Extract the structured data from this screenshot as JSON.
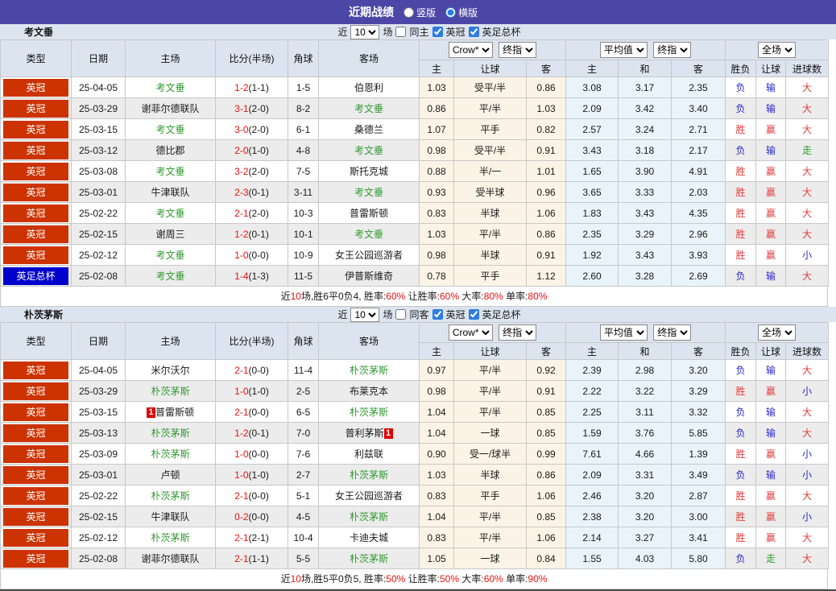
{
  "titlebar": {
    "title": "近期战绩",
    "radios": [
      {
        "label": "竖版",
        "selected": false
      },
      {
        "label": "横版",
        "selected": true
      }
    ]
  },
  "columns": {
    "main": [
      "类型",
      "日期",
      "主场",
      "比分(半场)",
      "角球",
      "客场"
    ],
    "sub": [
      "主",
      "让球",
      "客",
      "主",
      "和",
      "客",
      "胜负",
      "让球",
      "进球数"
    ]
  },
  "dropdowns": {
    "book": "Crow*",
    "book_period": "终指",
    "avg": "平均值",
    "avg_period": "终指",
    "scope": "全场"
  },
  "colors": {
    "league_badge": "#cc3300",
    "cup_badge": "#0000cc",
    "team_highlight": "#339933",
    "score_red": "#ee1111",
    "win_red": "#e03c3c",
    "lose_blue": "#2828cc",
    "void_green": "#2e9a2e",
    "titlebar_bg": "#4c46a6",
    "header_bg": "#dce4f0"
  },
  "sections": [
    {
      "team": "考文垂",
      "filter": {
        "near": "近",
        "count": "10",
        "games": "场",
        "same_label": "同主",
        "same_checked": false,
        "league_label": "英冠",
        "league_checked": true,
        "cup_label": "英足总杯",
        "cup_checked": true
      },
      "rows": [
        {
          "league": "英冠",
          "cup": false,
          "date": "25-04-05",
          "home": {
            "name": "考文垂",
            "green": true
          },
          "score": "1-2",
          "half": "(1-1)",
          "corners": "1-5",
          "away": {
            "name": "伯恩利",
            "green": false
          },
          "odds": [
            "1.03",
            "受平/半",
            "0.86"
          ],
          "avg": [
            "3.08",
            "3.17",
            "2.35"
          ],
          "res": [
            [
              "负",
              "b"
            ],
            [
              "输",
              "b"
            ],
            [
              "大",
              "r"
            ]
          ]
        },
        {
          "league": "英冠",
          "cup": false,
          "date": "25-03-29",
          "home": {
            "name": "谢菲尔德联队",
            "green": false
          },
          "score": "3-1",
          "half": "(2-0)",
          "corners": "8-2",
          "away": {
            "name": "考文垂",
            "green": true
          },
          "odds": [
            "0.86",
            "平/半",
            "1.03"
          ],
          "avg": [
            "2.09",
            "3.42",
            "3.40"
          ],
          "res": [
            [
              "负",
              "b"
            ],
            [
              "输",
              "b"
            ],
            [
              "大",
              "r"
            ]
          ]
        },
        {
          "league": "英冠",
          "cup": false,
          "date": "25-03-15",
          "home": {
            "name": "考文垂",
            "green": true
          },
          "score": "3-0",
          "half": "(2-0)",
          "corners": "6-1",
          "away": {
            "name": "桑德兰",
            "green": false
          },
          "odds": [
            "1.07",
            "平手",
            "0.82"
          ],
          "avg": [
            "2.57",
            "3.24",
            "2.71"
          ],
          "res": [
            [
              "胜",
              "r"
            ],
            [
              "赢",
              "r"
            ],
            [
              "大",
              "r"
            ]
          ]
        },
        {
          "league": "英冠",
          "cup": false,
          "date": "25-03-12",
          "home": {
            "name": "德比郡",
            "green": false
          },
          "score": "2-0",
          "half": "(1-0)",
          "corners": "4-8",
          "away": {
            "name": "考文垂",
            "green": true
          },
          "odds": [
            "0.98",
            "受平/半",
            "0.91"
          ],
          "avg": [
            "3.43",
            "3.18",
            "2.17"
          ],
          "res": [
            [
              "负",
              "b"
            ],
            [
              "输",
              "b"
            ],
            [
              "走",
              "g"
            ]
          ]
        },
        {
          "league": "英冠",
          "cup": false,
          "date": "25-03-08",
          "home": {
            "name": "考文垂",
            "green": true
          },
          "score": "3-2",
          "half": "(2-0)",
          "corners": "7-5",
          "away": {
            "name": "斯托克城",
            "green": false
          },
          "odds": [
            "0.88",
            "半/一",
            "1.01"
          ],
          "avg": [
            "1.65",
            "3.90",
            "4.91"
          ],
          "res": [
            [
              "胜",
              "r"
            ],
            [
              "赢",
              "r"
            ],
            [
              "大",
              "r"
            ]
          ]
        },
        {
          "league": "英冠",
          "cup": false,
          "date": "25-03-01",
          "home": {
            "name": "牛津联队",
            "green": false
          },
          "score": "2-3",
          "half": "(0-1)",
          "corners": "3-11",
          "away": {
            "name": "考文垂",
            "green": true
          },
          "odds": [
            "0.93",
            "受半球",
            "0.96"
          ],
          "avg": [
            "3.65",
            "3.33",
            "2.03"
          ],
          "res": [
            [
              "胜",
              "r"
            ],
            [
              "赢",
              "r"
            ],
            [
              "大",
              "r"
            ]
          ]
        },
        {
          "league": "英冠",
          "cup": false,
          "date": "25-02-22",
          "home": {
            "name": "考文垂",
            "green": true
          },
          "score": "2-1",
          "half": "(2-0)",
          "corners": "10-3",
          "away": {
            "name": "普雷斯顿",
            "green": false
          },
          "odds": [
            "0.83",
            "半球",
            "1.06"
          ],
          "avg": [
            "1.83",
            "3.43",
            "4.35"
          ],
          "res": [
            [
              "胜",
              "r"
            ],
            [
              "赢",
              "r"
            ],
            [
              "大",
              "r"
            ]
          ]
        },
        {
          "league": "英冠",
          "cup": false,
          "date": "25-02-15",
          "home": {
            "name": "谢周三",
            "green": false
          },
          "score": "1-2",
          "half": "(0-1)",
          "corners": "10-1",
          "away": {
            "name": "考文垂",
            "green": true
          },
          "odds": [
            "1.03",
            "平/半",
            "0.86"
          ],
          "avg": [
            "2.35",
            "3.29",
            "2.96"
          ],
          "res": [
            [
              "胜",
              "r"
            ],
            [
              "赢",
              "r"
            ],
            [
              "大",
              "r"
            ]
          ]
        },
        {
          "league": "英冠",
          "cup": false,
          "date": "25-02-12",
          "home": {
            "name": "考文垂",
            "green": true
          },
          "score": "1-0",
          "half": "(0-0)",
          "corners": "10-9",
          "away": {
            "name": "女王公园巡游者",
            "green": false
          },
          "odds": [
            "0.98",
            "半球",
            "0.91"
          ],
          "avg": [
            "1.92",
            "3.43",
            "3.93"
          ],
          "res": [
            [
              "胜",
              "r"
            ],
            [
              "赢",
              "r"
            ],
            [
              "小",
              "b"
            ]
          ]
        },
        {
          "league": "英足总杯",
          "cup": true,
          "date": "25-02-08",
          "home": {
            "name": "考文垂",
            "green": true
          },
          "score": "1-4",
          "half": "(1-3)",
          "corners": "11-5",
          "away": {
            "name": "伊普斯维奇",
            "green": false
          },
          "odds": [
            "0.78",
            "平手",
            "1.12"
          ],
          "avg": [
            "2.60",
            "3.28",
            "2.69"
          ],
          "res": [
            [
              "负",
              "b"
            ],
            [
              "输",
              "b"
            ],
            [
              "大",
              "r"
            ]
          ]
        }
      ],
      "summary": [
        [
          "近",
          0
        ],
        [
          "10",
          1
        ],
        [
          "场,胜6平0负4, 胜率:",
          0
        ],
        [
          "60%",
          1
        ],
        [
          " 让胜率:",
          0
        ],
        [
          "60%",
          1
        ],
        [
          " 大率:",
          0
        ],
        [
          "80%",
          1
        ],
        [
          " 单率:",
          0
        ],
        [
          "80%",
          1
        ]
      ]
    },
    {
      "team": "朴茨茅斯",
      "filter": {
        "near": "近",
        "count": "10",
        "games": "场",
        "same_label": "同客",
        "same_checked": false,
        "league_label": "英冠",
        "league_checked": true,
        "cup_label": "英足总杯",
        "cup_checked": true
      },
      "rows": [
        {
          "league": "英冠",
          "cup": false,
          "date": "25-04-05",
          "home": {
            "name": "米尔沃尔",
            "green": false
          },
          "score": "2-1",
          "half": "(0-0)",
          "corners": "11-4",
          "away": {
            "name": "朴茨茅斯",
            "green": true
          },
          "odds": [
            "0.97",
            "平/半",
            "0.92"
          ],
          "avg": [
            "2.39",
            "2.98",
            "3.20"
          ],
          "res": [
            [
              "负",
              "b"
            ],
            [
              "输",
              "b"
            ],
            [
              "大",
              "r"
            ]
          ]
        },
        {
          "league": "英冠",
          "cup": false,
          "date": "25-03-29",
          "home": {
            "name": "朴茨茅斯",
            "green": true
          },
          "score": "1-0",
          "half": "(1-0)",
          "corners": "2-5",
          "away": {
            "name": "布莱克本",
            "green": false
          },
          "odds": [
            "0.98",
            "平/半",
            "0.91"
          ],
          "avg": [
            "2.22",
            "3.22",
            "3.29"
          ],
          "res": [
            [
              "胜",
              "r"
            ],
            [
              "赢",
              "r"
            ],
            [
              "小",
              "b"
            ]
          ]
        },
        {
          "league": "英冠",
          "cup": false,
          "date": "25-03-15",
          "home": {
            "name": "普雷斯顿",
            "green": false,
            "card": "1",
            "card_pos": "before"
          },
          "score": "2-1",
          "half": "(0-0)",
          "corners": "6-5",
          "away": {
            "name": "朴茨茅斯",
            "green": true
          },
          "odds": [
            "1.04",
            "平/半",
            "0.85"
          ],
          "avg": [
            "2.25",
            "3.11",
            "3.32"
          ],
          "res": [
            [
              "负",
              "b"
            ],
            [
              "输",
              "b"
            ],
            [
              "大",
              "r"
            ]
          ]
        },
        {
          "league": "英冠",
          "cup": false,
          "date": "25-03-13",
          "home": {
            "name": "朴茨茅斯",
            "green": true
          },
          "score": "1-2",
          "half": "(0-1)",
          "corners": "7-0",
          "away": {
            "name": "普利茅斯",
            "green": false,
            "card": "1",
            "card_pos": "after"
          },
          "odds": [
            "1.04",
            "一球",
            "0.85"
          ],
          "avg": [
            "1.59",
            "3.76",
            "5.85"
          ],
          "res": [
            [
              "负",
              "b"
            ],
            [
              "输",
              "b"
            ],
            [
              "大",
              "r"
            ]
          ]
        },
        {
          "league": "英冠",
          "cup": false,
          "date": "25-03-09",
          "home": {
            "name": "朴茨茅斯",
            "green": true
          },
          "score": "1-0",
          "half": "(0-0)",
          "corners": "7-6",
          "away": {
            "name": "利兹联",
            "green": false
          },
          "odds": [
            "0.90",
            "受一/球半",
            "0.99"
          ],
          "avg": [
            "7.61",
            "4.66",
            "1.39"
          ],
          "res": [
            [
              "胜",
              "r"
            ],
            [
              "赢",
              "r"
            ],
            [
              "小",
              "b"
            ]
          ]
        },
        {
          "league": "英冠",
          "cup": false,
          "date": "25-03-01",
          "home": {
            "name": "卢顿",
            "green": false
          },
          "score": "1-0",
          "half": "(1-0)",
          "corners": "2-7",
          "away": {
            "name": "朴茨茅斯",
            "green": true
          },
          "odds": [
            "1.03",
            "半球",
            "0.86"
          ],
          "avg": [
            "2.09",
            "3.31",
            "3.49"
          ],
          "res": [
            [
              "负",
              "b"
            ],
            [
              "输",
              "b"
            ],
            [
              "小",
              "b"
            ]
          ]
        },
        {
          "league": "英冠",
          "cup": false,
          "date": "25-02-22",
          "home": {
            "name": "朴茨茅斯",
            "green": true
          },
          "score": "2-1",
          "half": "(0-0)",
          "corners": "5-1",
          "away": {
            "name": "女王公园巡游者",
            "green": false
          },
          "odds": [
            "0.83",
            "平手",
            "1.06"
          ],
          "avg": [
            "2.46",
            "3.20",
            "2.87"
          ],
          "res": [
            [
              "胜",
              "r"
            ],
            [
              "赢",
              "r"
            ],
            [
              "大",
              "r"
            ]
          ]
        },
        {
          "league": "英冠",
          "cup": false,
          "date": "25-02-15",
          "home": {
            "name": "牛津联队",
            "green": false
          },
          "score": "0-2",
          "half": "(0-0)",
          "corners": "4-5",
          "away": {
            "name": "朴茨茅斯",
            "green": true
          },
          "odds": [
            "1.04",
            "平/半",
            "0.85"
          ],
          "avg": [
            "2.38",
            "3.20",
            "3.00"
          ],
          "res": [
            [
              "胜",
              "r"
            ],
            [
              "赢",
              "r"
            ],
            [
              "小",
              "b"
            ]
          ]
        },
        {
          "league": "英冠",
          "cup": false,
          "date": "25-02-12",
          "home": {
            "name": "朴茨茅斯",
            "green": true
          },
          "score": "2-1",
          "half": "(2-1)",
          "corners": "10-4",
          "away": {
            "name": "卡迪夫城",
            "green": false
          },
          "odds": [
            "0.83",
            "平/半",
            "1.06"
          ],
          "avg": [
            "2.14",
            "3.27",
            "3.41"
          ],
          "res": [
            [
              "胜",
              "r"
            ],
            [
              "赢",
              "r"
            ],
            [
              "大",
              "r"
            ]
          ]
        },
        {
          "league": "英冠",
          "cup": false,
          "date": "25-02-08",
          "home": {
            "name": "谢菲尔德联队",
            "green": false
          },
          "score": "2-1",
          "half": "(1-1)",
          "corners": "5-5",
          "away": {
            "name": "朴茨茅斯",
            "green": true
          },
          "odds": [
            "1.05",
            "一球",
            "0.84"
          ],
          "avg": [
            "1.55",
            "4.03",
            "5.80"
          ],
          "res": [
            [
              "负",
              "b"
            ],
            [
              "走",
              "g"
            ],
            [
              "大",
              "r"
            ]
          ]
        }
      ],
      "summary": [
        [
          "近",
          0
        ],
        [
          "10",
          1
        ],
        [
          "场,胜5平0负5, 胜率:",
          0
        ],
        [
          "50%",
          1
        ],
        [
          " 让胜率:",
          0
        ],
        [
          "50%",
          1
        ],
        [
          " 大率:",
          0
        ],
        [
          "60%",
          1
        ],
        [
          " 单率:",
          0
        ],
        [
          "90%",
          1
        ]
      ]
    }
  ]
}
